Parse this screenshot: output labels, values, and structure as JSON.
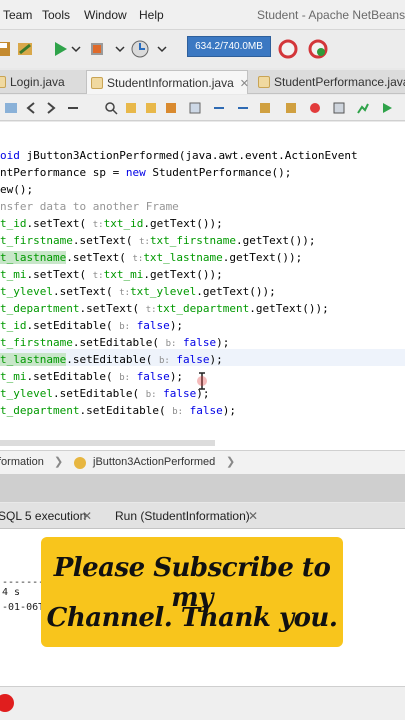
{
  "menu": [
    "Team",
    "Tools",
    "Window",
    "Help"
  ],
  "window_title": "Student - Apache NetBeans ID",
  "memory": "634.2/740.0MB",
  "tabs": [
    {
      "label": "Login.java",
      "active": false
    },
    {
      "label": "StudentInformation.java",
      "active": true
    },
    {
      "label": "StudentPerformance.java",
      "active": false
    }
  ],
  "code": {
    "l1_kw": "oid",
    "l1_rest": " jButton3ActionPerformed(java.awt.event.ActionEvent",
    "l2_a": "ntPerformance sp = ",
    "l2_kw": "new",
    "l2_b": " StudentPerformance();",
    "l3": "ew();",
    "l4": "nsfer data to another Frame",
    "rows": [
      {
        "f1": "t_id",
        "m": ".setText(",
        "h": "t:",
        "f2": "txt_id",
        "e": ".getText());"
      },
      {
        "f1": "t_firstname",
        "m": ".setText(",
        "h": "t:",
        "f2": "txt_firstname",
        "e": ".getText());"
      },
      {
        "f1": "t_lastname",
        "m": ".setText(",
        "h": "t:",
        "f2": "txt_lastname",
        "e": ".getText());"
      },
      {
        "f1": "t_mi",
        "m": ".setText(",
        "h": "t:",
        "f2": "txt_mi",
        "e": ".getText());"
      },
      {
        "f1": "t_ylevel",
        "m": ".setText(",
        "h": "t:",
        "f2": "txt_ylevel",
        "e": ".getText());"
      },
      {
        "f1": "t_department",
        "m": ".setText(",
        "h": "t:",
        "f2": "txt_department",
        "e": ".getText());"
      }
    ],
    "editable_rows": [
      {
        "f1": "t_id",
        "m": ".setEditable(",
        "h": "b:",
        "v": "false",
        "e": ");"
      },
      {
        "f1": "t_firstname",
        "m": ".setEditable(",
        "h": "b:",
        "v": "false",
        "e": ");"
      },
      {
        "f1": "t_lastname",
        "m": ".setEditable(",
        "h": "b:",
        "v": "false",
        "e": ");"
      },
      {
        "f1": "t_mi",
        "m": ".setEditable(",
        "h": "b:",
        "v": "false",
        "e": ");"
      },
      {
        "f1": "t_ylevel",
        "m": ".setEditable(",
        "h": "b:",
        "v": "false",
        "e": ");"
      },
      {
        "f1": "t_department",
        "m": ".setEditable(",
        "h": "b:",
        "v": "false",
        "e": ");"
      }
    ]
  },
  "breadcrumb": {
    "class": "formation",
    "method": "jButton3ActionPerformed"
  },
  "output_tabs": [
    "SQL 5 execution",
    "Run (StudentInformation)"
  ],
  "output_lines": [
    "--------------",
    "4 s",
    "-01-06T"
  ],
  "banner": {
    "line1": "Please Subscribe to my",
    "line2": "Channel. Thank you."
  },
  "colors": {
    "accent": "#3b78c2",
    "banner": "#f8c51c"
  }
}
